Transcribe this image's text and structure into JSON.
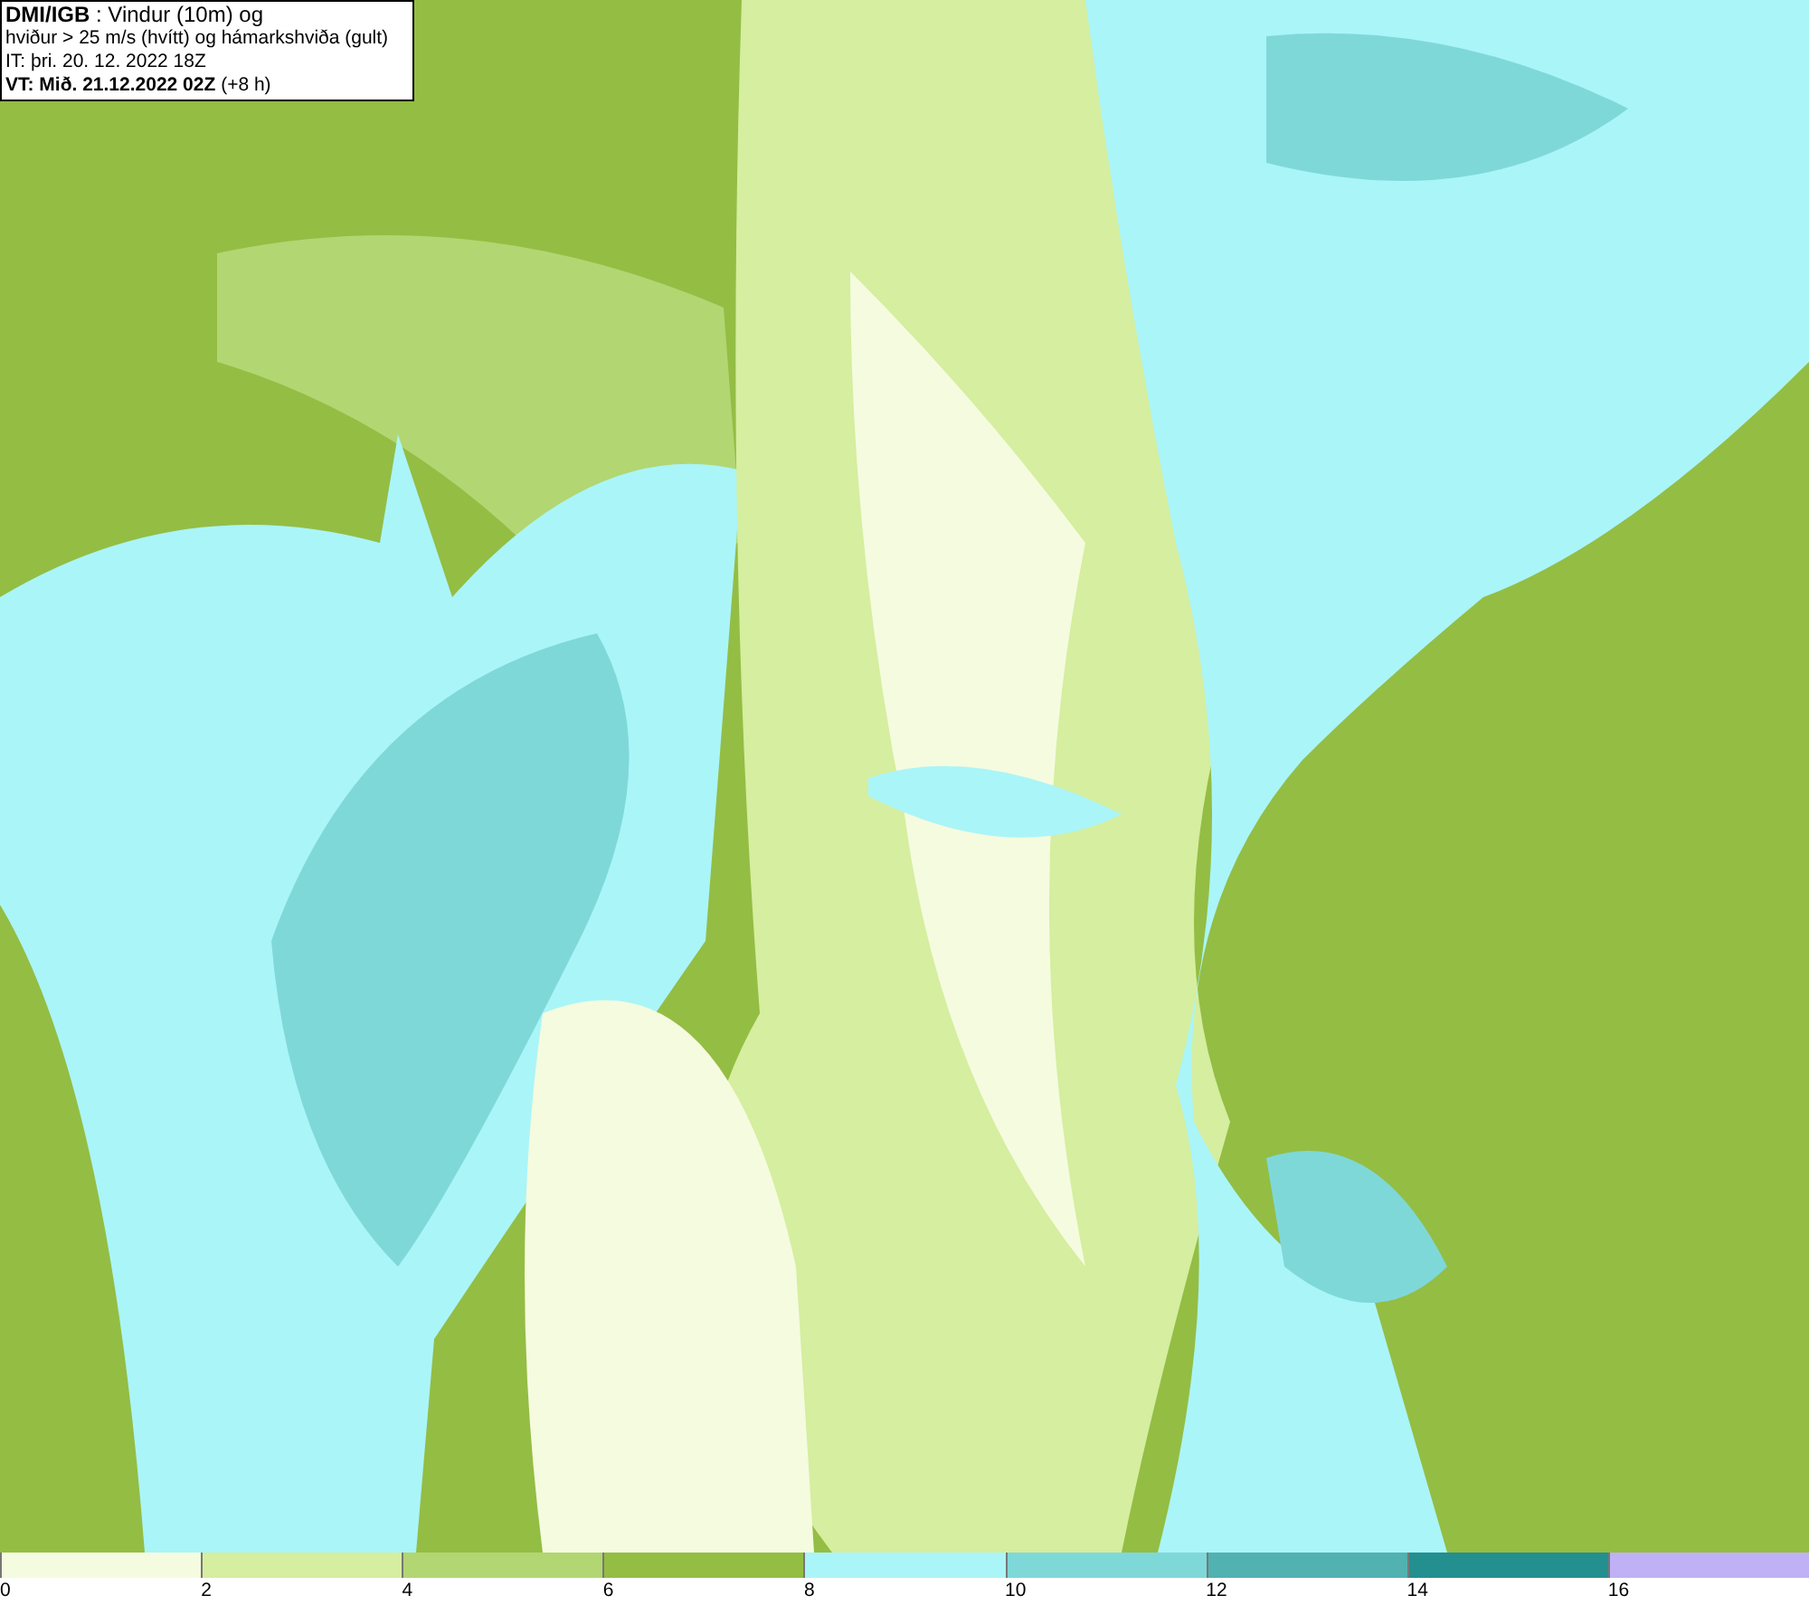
{
  "header": {
    "lines": [
      "**DMI/IGB** : Vindur (10m) og",
      "hviður > 25 m/s (hvítt) og hámarkshviða (gult)",
      "IT: þri. 20. 12. 2022 18Z",
      "**VT: Mið. 21.12.2022 02Z** (+8 h)"
    ]
  },
  "legend": [
    {
      "color": "#f5fbdf",
      "label": "0"
    },
    {
      "color": "#d5ee9f",
      "label": "2"
    },
    {
      "color": "#b2d672",
      "label": "4"
    },
    {
      "color": "#94bd44",
      "label": "6"
    },
    {
      "color": "#aaf5f8",
      "label": "8"
    },
    {
      "color": "#7fd8d8",
      "label": "10"
    },
    {
      "color": "#52b1b1",
      "label": "12"
    },
    {
      "color": "#238f8f",
      "label": "14"
    },
    {
      "color": "#c0b0f5",
      "label": "16"
    }
  ]
}
